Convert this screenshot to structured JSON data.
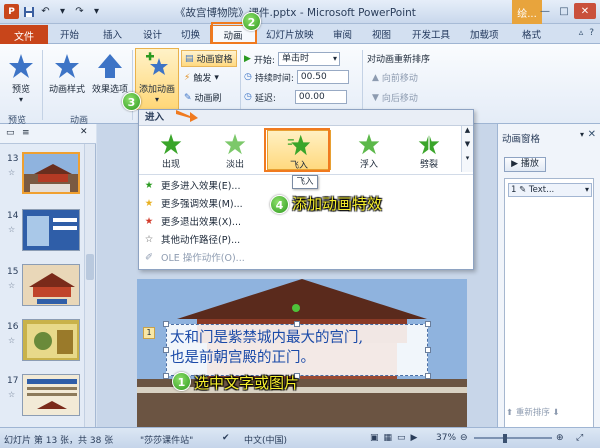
{
  "titlebar": {
    "title": "《故宫博物院》课件.pptx - Microsoft PowerPoint",
    "context_tab": "绘..."
  },
  "tabs": {
    "file": "文件",
    "items": [
      "开始",
      "插入",
      "设计",
      "切换",
      "动画",
      "幻灯片放映",
      "审阅",
      "视图",
      "开发工具",
      "加载项",
      "格式"
    ]
  },
  "ribbon": {
    "preview": "预览",
    "preview_group": "预览",
    "anim_style": "动画样式",
    "effect_options": "效果选项",
    "anim_group": "动画",
    "add_animation": "添加动画",
    "anim_pane": "动画窗格",
    "trigger": "触发",
    "anim_painter": "动画刷",
    "start_label": "开始:",
    "start_value": "单击时",
    "duration_label": "持续时间:",
    "duration_value": "00.50",
    "delay_label": "延迟:",
    "delay_value": "00.00",
    "reorder_title": "对动画重新排序",
    "move_earlier": "向前移动",
    "move_later": "向后移动"
  },
  "gallery": {
    "header": "进入",
    "items": [
      "出现",
      "淡出",
      "飞入",
      "浮入",
      "劈裂"
    ],
    "menu": [
      "更多进入效果(E)...",
      "更多强调效果(M)...",
      "更多退出效果(X)...",
      "其他动作路径(P)...",
      "OLE 操作动作(O)..."
    ],
    "tooltip": "飞入"
  },
  "thumbs": {
    "numbers": [
      "13",
      "14",
      "15",
      "16",
      "17"
    ]
  },
  "slide": {
    "line1": "太和门是紫禁城内最大的宫门,",
    "line2": "也是前朝宫殿的正门。",
    "tag": "1"
  },
  "animpane": {
    "title": "动画窗格",
    "play": "播放",
    "entry": "1 ✎ Text...",
    "reorder": "重新排序"
  },
  "statusbar": {
    "slide_info": "幻灯片 第 13 张，共 38 张",
    "theme": "\"莎莎课件站\"",
    "language": "中文(中国)",
    "zoom": "37%"
  },
  "annotations": {
    "step1_num": "1",
    "step1_text": "选中文字或图片",
    "step2_num": "2",
    "step3_num": "3",
    "step4_num": "4",
    "step4_text": "添加动画特效"
  },
  "colors": {
    "file_tab": "#c8451a",
    "highlight_orange": "#f07a1f",
    "annotation_yellow": "#f7ef2e",
    "slide_text_blue": "#1a4aa8"
  }
}
